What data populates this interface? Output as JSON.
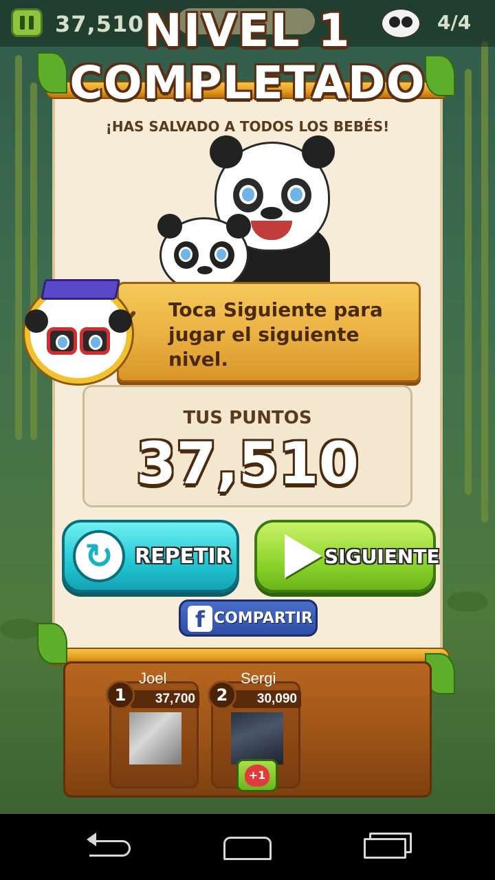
{
  "hud": {
    "score": "37,510",
    "babies_counter": "4/4",
    "pause_icon": "pause-icon",
    "panda_icon": "panda-face-icon"
  },
  "result": {
    "title_line1": "NIVEL 1",
    "title_line2": "COMPLETADO",
    "subtitle": "¡HAS SALVADO A TODOS LOS BEBÉS!"
  },
  "tutorial": {
    "message": "Toca Siguiente para jugar el siguiente nivel."
  },
  "points": {
    "label": "TUS PUNTOS",
    "value": "37,510"
  },
  "buttons": {
    "repeat_label": "REPETIR",
    "next_label": "SIGUIENTE",
    "share_label": "COMPARTIR",
    "share_icon_glyph": "f"
  },
  "leaderboard": [
    {
      "rank": "1",
      "name": "Joel",
      "score": "37,700"
    },
    {
      "rank": "2",
      "name": "Sergi",
      "score": "30,090",
      "gift_label": "+1"
    }
  ],
  "colors": {
    "repeat_button": "#22c7d3",
    "next_button": "#8dd42b",
    "share_button": "#2e4ea6",
    "banner": "#eab042",
    "panel": "#f6ecd8"
  }
}
